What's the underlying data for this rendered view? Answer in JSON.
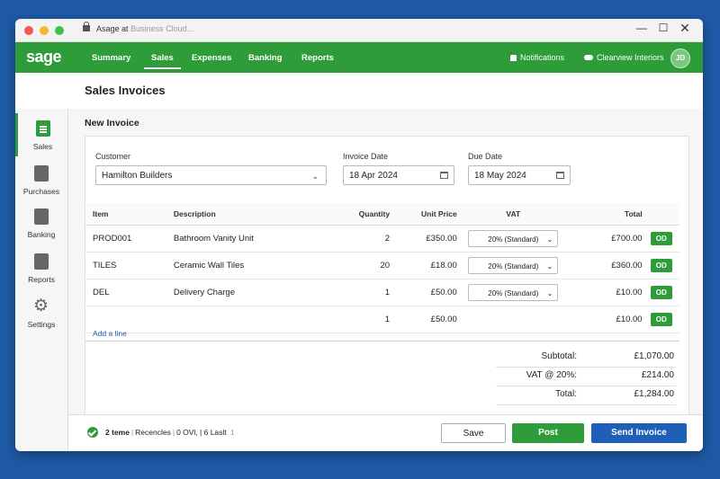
{
  "window": {
    "title_prefix": "Asage at",
    "title_suffix": "Business Cloud..."
  },
  "nav": {
    "logo": "sage",
    "tabs": [
      {
        "label": "Summary"
      },
      {
        "label": "Sales"
      },
      {
        "label": "Expenses"
      },
      {
        "label": "Banking"
      },
      {
        "label": "Reports"
      }
    ],
    "notifications": "Notifications",
    "company": "Clearview Interiors",
    "avatar_initials": "JD"
  },
  "page": {
    "title": "Sales Invoices",
    "section": "New Invoice"
  },
  "sidebar": {
    "items": [
      {
        "label": "Sales",
        "icon": "document-icon"
      },
      {
        "label": "Purchases",
        "icon": "purchases-icon"
      },
      {
        "label": "Banking",
        "icon": "bank-icon"
      },
      {
        "label": "Reports",
        "icon": "report-icon"
      },
      {
        "label": "Settings",
        "icon": "gear-icon"
      }
    ]
  },
  "form": {
    "customer_label": "Customer",
    "customer_value": "Hamilton Builders",
    "invoice_date_label": "Invoice Date",
    "invoice_date_value": "18 Apr 2024",
    "due_date_label": "Due Date",
    "due_date_value": "18 May 2024"
  },
  "table": {
    "headers": {
      "item": "Item",
      "description": "Description",
      "quantity": "Quantity",
      "unit_price": "Unit Price",
      "vat": "VAT",
      "total": "Total"
    },
    "rows": [
      {
        "item": "PROD001",
        "description": "Bathroom Vanity Unit",
        "quantity": "2",
        "unit_price": "£350.00",
        "vat": "20% (Standard)",
        "total": "£700.00",
        "action": "OD"
      },
      {
        "item": "TILES",
        "description": "Ceramic Wall Tiles",
        "quantity": "20",
        "unit_price": "£18.00",
        "vat": "20% (Standard)",
        "total": "£360.00",
        "action": "OD"
      },
      {
        "item": "DEL",
        "description": "Delivery Charge",
        "quantity": "1",
        "unit_price": "£50.00",
        "vat": "20% (Standard)",
        "total": "£10.00",
        "action": "OD"
      },
      {
        "item": "",
        "description": "",
        "quantity": "1",
        "unit_price": "£50.00",
        "vat": "",
        "total": "£10.00",
        "action": "OD"
      }
    ],
    "add_line": "Add a line"
  },
  "totals": {
    "subtotal_label": "Subtotal:",
    "subtotal_value": "£1,070.00",
    "vat_label": "VAT @ 20%:",
    "vat_value": "£214.00",
    "total_label": "Total:",
    "total_value": "£1,284.00"
  },
  "footer": {
    "status_a": "2 teme",
    "status_b": "Recencles",
    "status_c": "0 OVl, | 6 Laslt",
    "status_d": "1",
    "save": "Save",
    "post": "Post",
    "send": "Send Invoice"
  },
  "colors": {
    "brand_green": "#2f9c3a",
    "primary_blue": "#1e5fb8",
    "desktop": "#1f5aa6"
  }
}
